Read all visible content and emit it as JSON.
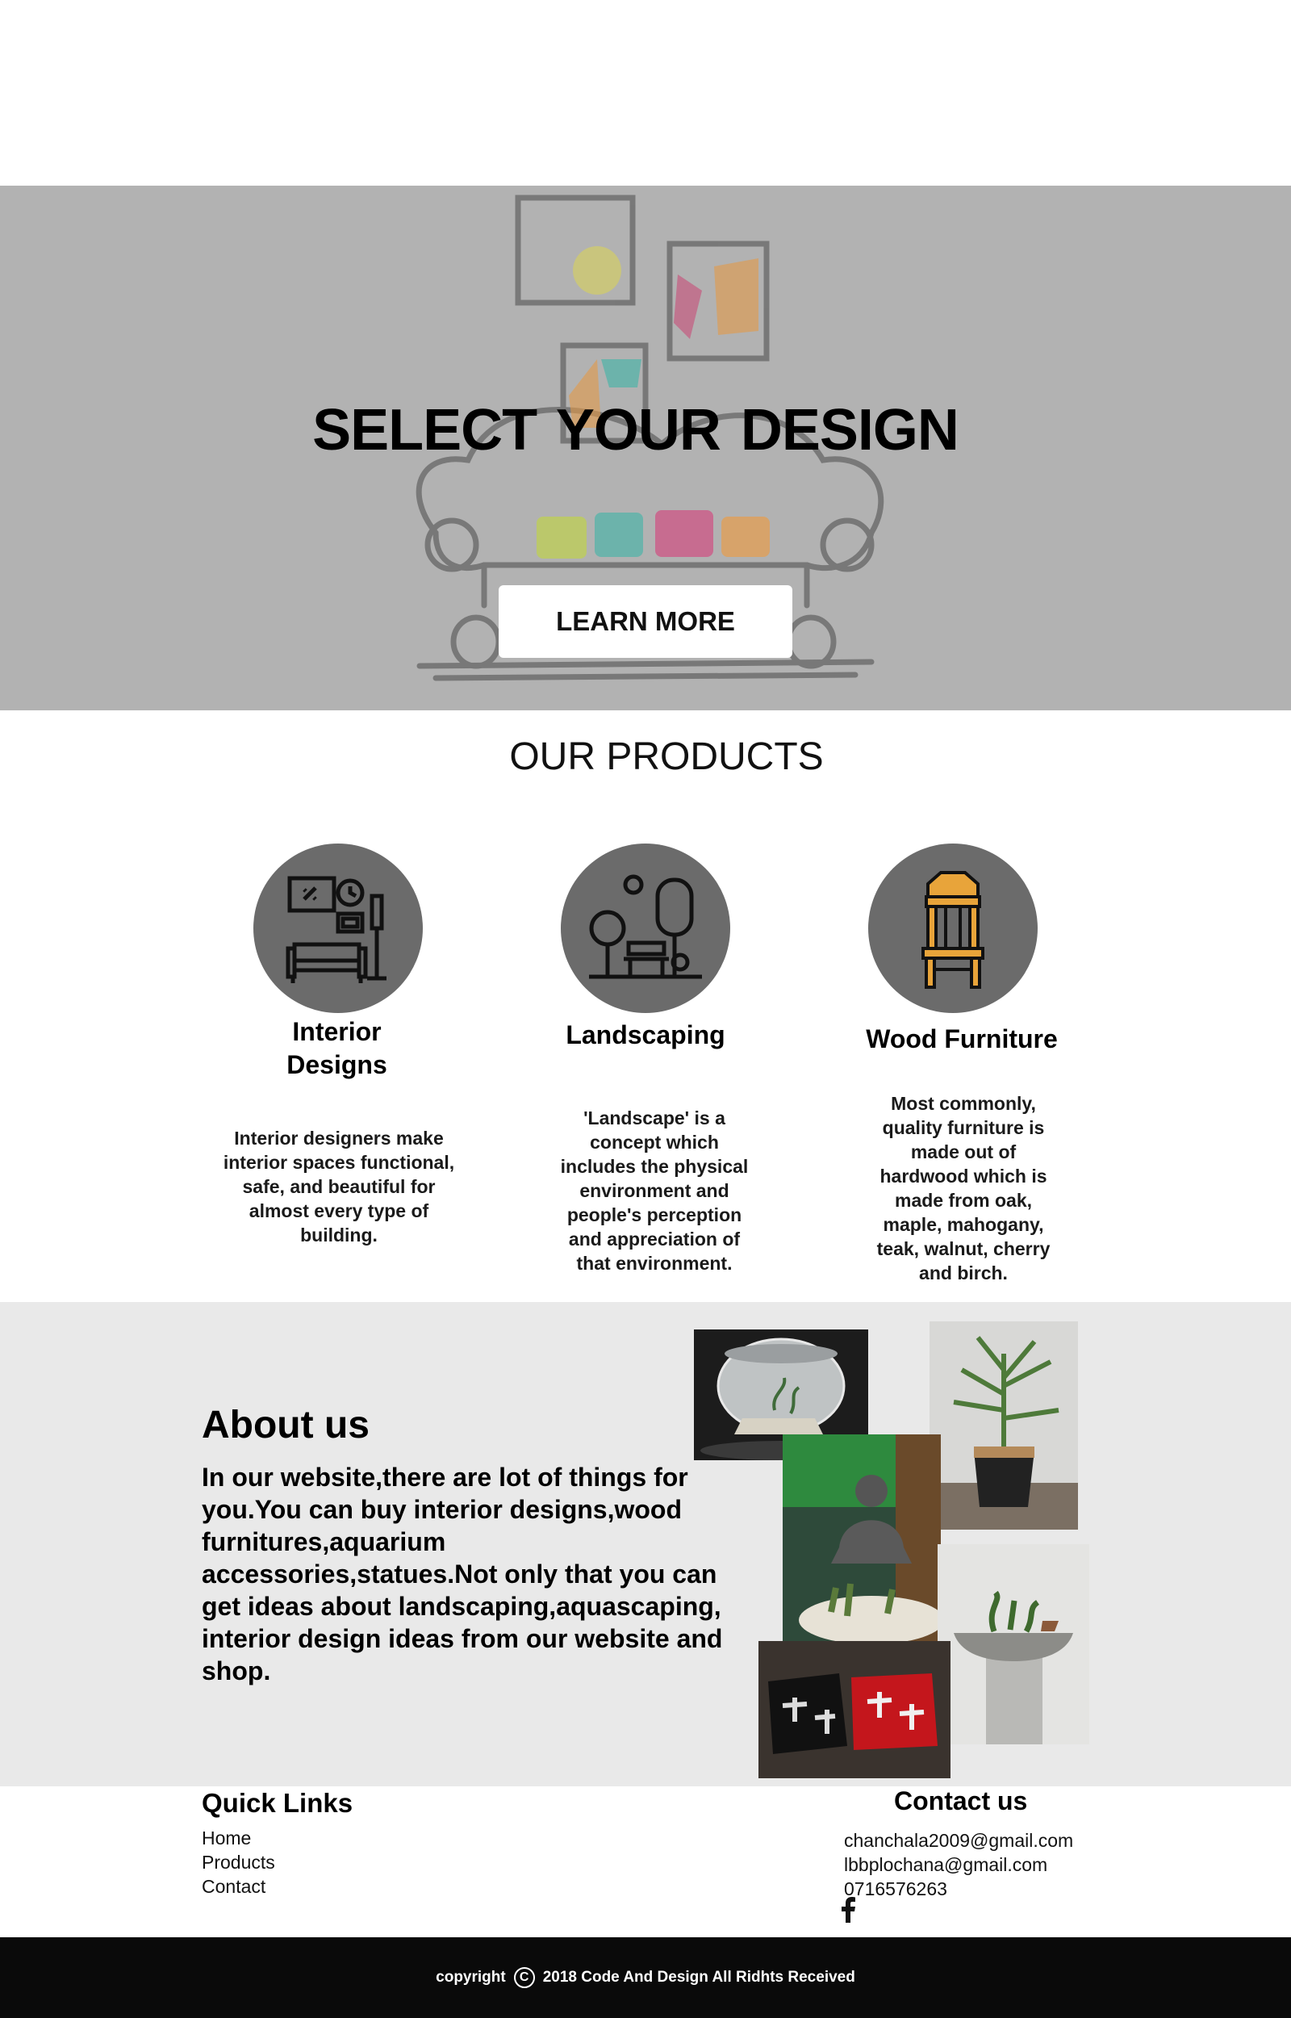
{
  "hero": {
    "title": "SELECT  YOUR DESIGN",
    "button_label": "LEARN MORE",
    "bg_color": "#b2b2b2"
  },
  "products": {
    "title": "OUR PRODUCTS",
    "items": [
      {
        "icon": "living-room-icon",
        "name": "Interior Designs",
        "description": "Interior designers make interior spaces functional, safe, and beautiful for almost every type of building."
      },
      {
        "icon": "park-icon",
        "name": "Landscaping",
        "description": "'Landscape' is a concept which includes the physical environment and people's perception and appreciation of that environment."
      },
      {
        "icon": "chair-icon",
        "name": "Wood Furniture",
        "description": "Most commonly, quality furniture is made out of hardwood which is made from oak, maple, mahogany, teak, walnut, cherry and birch."
      }
    ]
  },
  "about": {
    "title": "About us",
    "text": "In our website,there are lot of things for you.You can buy interior designs,wood furnitures,aquarium accessories,statues.Not only that you can get  ideas about landscaping,aquascaping, interior design ideas from our website and shop.",
    "bg_color": "#e9e9e9"
  },
  "quick_links": {
    "title": "Quick Links",
    "links": [
      "Home",
      "Products",
      "Contact"
    ]
  },
  "contact": {
    "title": "Contact us",
    "emails": [
      "chanchala2009@gmail.com",
      "lbbplochana@gmail.com"
    ],
    "phone": "0716576263",
    "social_icon": "facebook-icon"
  },
  "footer": {
    "copyright_prefix": "copyright",
    "copyright_symbol": "C",
    "copyright_text": "2018 Code  And Design All Ridhts Received",
    "bg_color": "#0a0a0a"
  }
}
